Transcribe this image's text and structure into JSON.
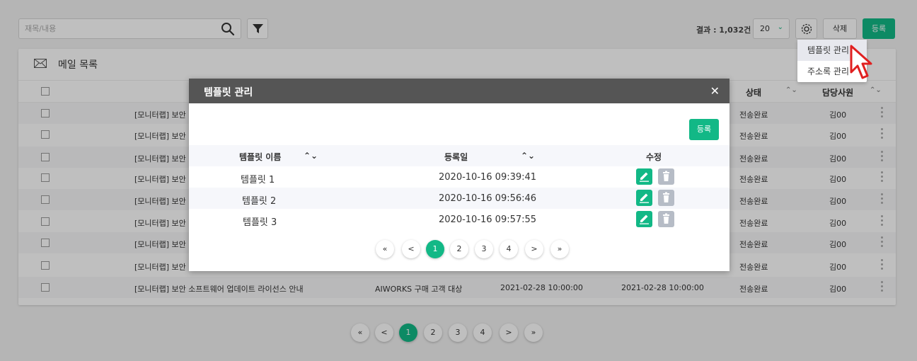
{
  "toolbar": {
    "search_placeholder": "재목/내용",
    "result_label": "결과 : 1,032건",
    "per_page": "20",
    "delete_label": "삭제",
    "register_label": "등록"
  },
  "card": {
    "title": "메일 목록",
    "columns": {
      "status": "상태",
      "owner": "담당사원"
    },
    "rows": [
      {
        "subject": "[모니터랩] 보안",
        "status": "전송완료",
        "owner": "김00"
      },
      {
        "subject": "[모니터랩] 보안",
        "status": "전송완료",
        "owner": "김00"
      },
      {
        "subject": "[모니터랩] 보안",
        "status": "전송완료",
        "owner": "김00"
      },
      {
        "subject": "[모니터랩] 보안",
        "status": "전송완료",
        "owner": "김00"
      },
      {
        "subject": "[모니터랩] 보안",
        "status": "전송완료",
        "owner": "김00"
      },
      {
        "subject": "[모니터랩] 보안",
        "status": "전송완료",
        "owner": "김00"
      },
      {
        "subject": "[모니터랩] 보안",
        "status": "전송완료",
        "owner": "김00"
      },
      {
        "subject": "[모니터랩] 보안",
        "status": "전송완료",
        "owner": "김00"
      },
      {
        "subject": "[모니터랩] 보안 소프트웨어 업데이트 라이선스 안내",
        "target": "AIWORKS 구매 고객 대상",
        "date1": "2021-02-28 10:00:00",
        "date2": "2021-02-28 10:00:00",
        "status": "전송완료",
        "owner": "김00"
      }
    ]
  },
  "pagination": {
    "first": "«",
    "prev": "<",
    "pages": [
      "1",
      "2",
      "3",
      "4"
    ],
    "next": ">",
    "last": "»",
    "current": "1"
  },
  "dropdown": {
    "items": [
      "템플릿 관리",
      "주소록 관리"
    ],
    "hovered": "템플릿 관리"
  },
  "modal": {
    "title": "템플릿 관리",
    "close": "✕",
    "register_label": "등록",
    "columns": {
      "name": "템플릿 이름",
      "date": "등록일",
      "edit": "수정"
    },
    "rows": [
      {
        "name": "템플릿 1",
        "date": "2020-10-16 09:39:41"
      },
      {
        "name": "템플릿 2",
        "date": "2020-10-16 09:56:46"
      },
      {
        "name": "템플릿 3",
        "date": "2020-10-16 09:57:55"
      }
    ],
    "pagination": {
      "first": "«",
      "prev": "<",
      "pages": [
        "1",
        "2",
        "3",
        "4"
      ],
      "next": ">",
      "last": "»",
      "current": "1"
    }
  },
  "colors": {
    "accent": "#12b886",
    "modal_header": "#555555",
    "trash_button": "#b6bcc6"
  }
}
